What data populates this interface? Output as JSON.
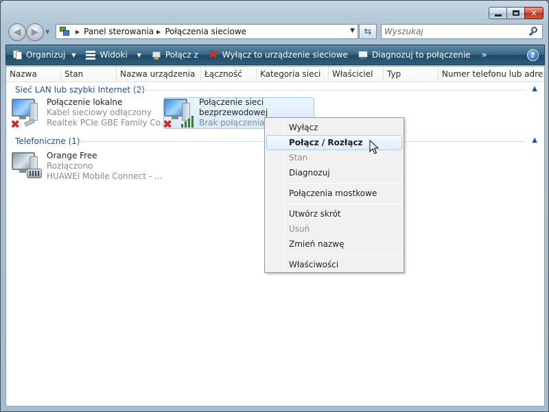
{
  "address": {
    "crumbs": [
      "Panel sterowania",
      "Połączenia sieciowe"
    ]
  },
  "search": {
    "placeholder": "Wyszukaj"
  },
  "toolbar": {
    "organize": "Organizuj",
    "views": "Widoki",
    "connect_to": "Połącz z",
    "disable_device": "Wyłącz to urządzenie sieciowe",
    "diagnose": "Diagnozuj to połączenie",
    "more": "»",
    "help": "?"
  },
  "columns": [
    "Nazwa",
    "Stan",
    "Nazwa urządzenia",
    "Łączność",
    "Kategoria sieci",
    "Właściciel",
    "Typ",
    "Numer telefonu lub adre..."
  ],
  "groups": {
    "lan": {
      "title": "Sieć LAN lub szybki Internet (2)",
      "items": [
        {
          "name": "Połączenie lokalne",
          "status": "Kabel sieciowy odłączony",
          "device": "Realtek PCIe GBE Family Co..."
        },
        {
          "name1": "Połączenie sieci",
          "name2": "bezprzewodowej",
          "status": "Brak połączenia"
        }
      ]
    },
    "phone": {
      "title": "Telefoniczne (1)",
      "items": [
        {
          "name": "Orange Free",
          "status": "Rozłączono",
          "device": "HUAWEI Mobile Connect - ..."
        }
      ]
    }
  },
  "context_menu": {
    "disable": "Wyłącz",
    "connect_disconnect": "Połącz / Rozłącz",
    "status": "Stan",
    "diagnose": "Diagnozuj",
    "bridge": "Połączenia mostkowe",
    "shortcut": "Utwórz skrót",
    "delete": "Usuń",
    "rename": "Zmień nazwę",
    "properties": "Właściwości"
  },
  "caption": {
    "minimize": "minimize",
    "maximize": "maximize",
    "close": "✕"
  }
}
